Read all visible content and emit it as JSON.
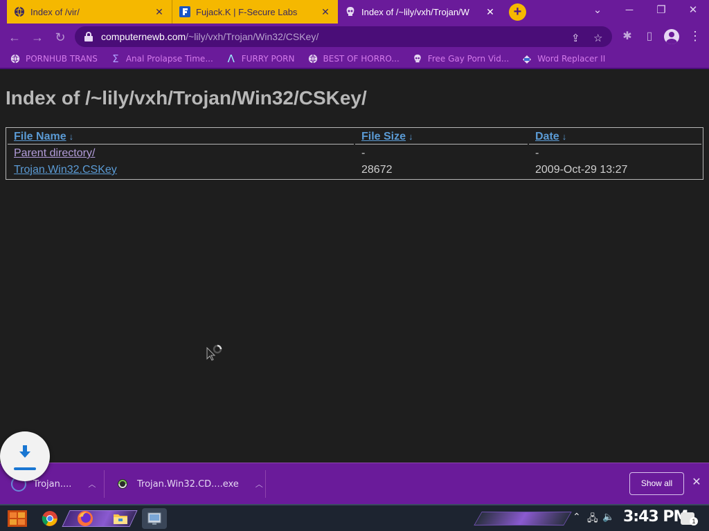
{
  "browser": {
    "tabs": [
      {
        "title": "Index of /vir/",
        "active": false
      },
      {
        "title": "Fujack.K | F-Secure Labs",
        "active": false
      },
      {
        "title": "Index of /~lily/vxh/Trojan/W",
        "active": true
      }
    ],
    "url_host": "computernewb.com",
    "url_path": "/~lily/vxh/Trojan/Win32/CSKey/",
    "bookmarks": [
      {
        "label": "PORNHUB TRANS",
        "icon": "globe-icon"
      },
      {
        "label": "Anal Prolapse Time...",
        "icon": "sigma-icon"
      },
      {
        "label": "FURRY PORN",
        "icon": "lambda-icon"
      },
      {
        "label": "BEST OF HORRO...",
        "icon": "globe-icon"
      },
      {
        "label": "Free Gay Porn Vid...",
        "icon": "skull-icon"
      },
      {
        "label": "Word Replacer II",
        "icon": "wr-icon"
      }
    ]
  },
  "page": {
    "heading": "Index of /~lily/vxh/Trojan/Win32/CSKey/",
    "columns": {
      "name": "File Name",
      "size": "File Size",
      "date": "Date",
      "sort_glyph": "↓"
    },
    "rows": [
      {
        "name": "Parent directory/",
        "size": "-",
        "date": "-"
      },
      {
        "name": "Trojan.Win32.CSKey",
        "size": "28672",
        "date": "2009-Oct-29 13:27"
      }
    ]
  },
  "downloads": {
    "items": [
      {
        "name": "Trojan...."
      },
      {
        "name": "Trojan.Win32.CD....exe"
      }
    ],
    "show_all": "Show all"
  },
  "taskbar": {
    "clock": "3:43 PM",
    "notification_count": "1"
  },
  "colors": {
    "browser_chrome": "#6a1b9a",
    "inactive_tab": "#f5b800",
    "page_bg": "#1e1e1e",
    "link": "#5b9bd5",
    "bookmark_text": "#d37bea"
  }
}
